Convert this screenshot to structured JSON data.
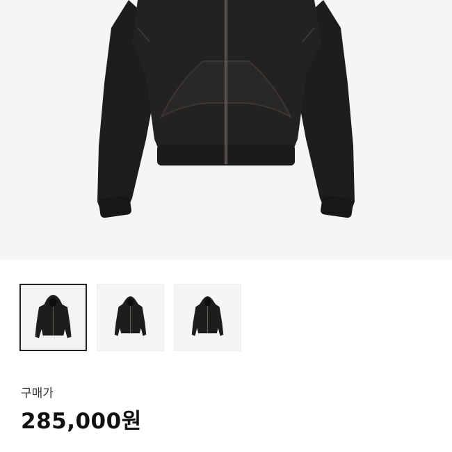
{
  "product": {
    "main_image_icon": "hoodie-image",
    "thumbnails": [
      {
        "icon": "hoodie-thumbnail",
        "selected": true
      },
      {
        "icon": "hoodie-thumbnail",
        "selected": false
      },
      {
        "icon": "hoodie-thumbnail",
        "selected": false
      }
    ],
    "price_label": "구매가",
    "price": "285,000원"
  },
  "colors": {
    "garment": "#1f1d1b",
    "background": "#f5f5f5",
    "selected_border": "#222222"
  }
}
